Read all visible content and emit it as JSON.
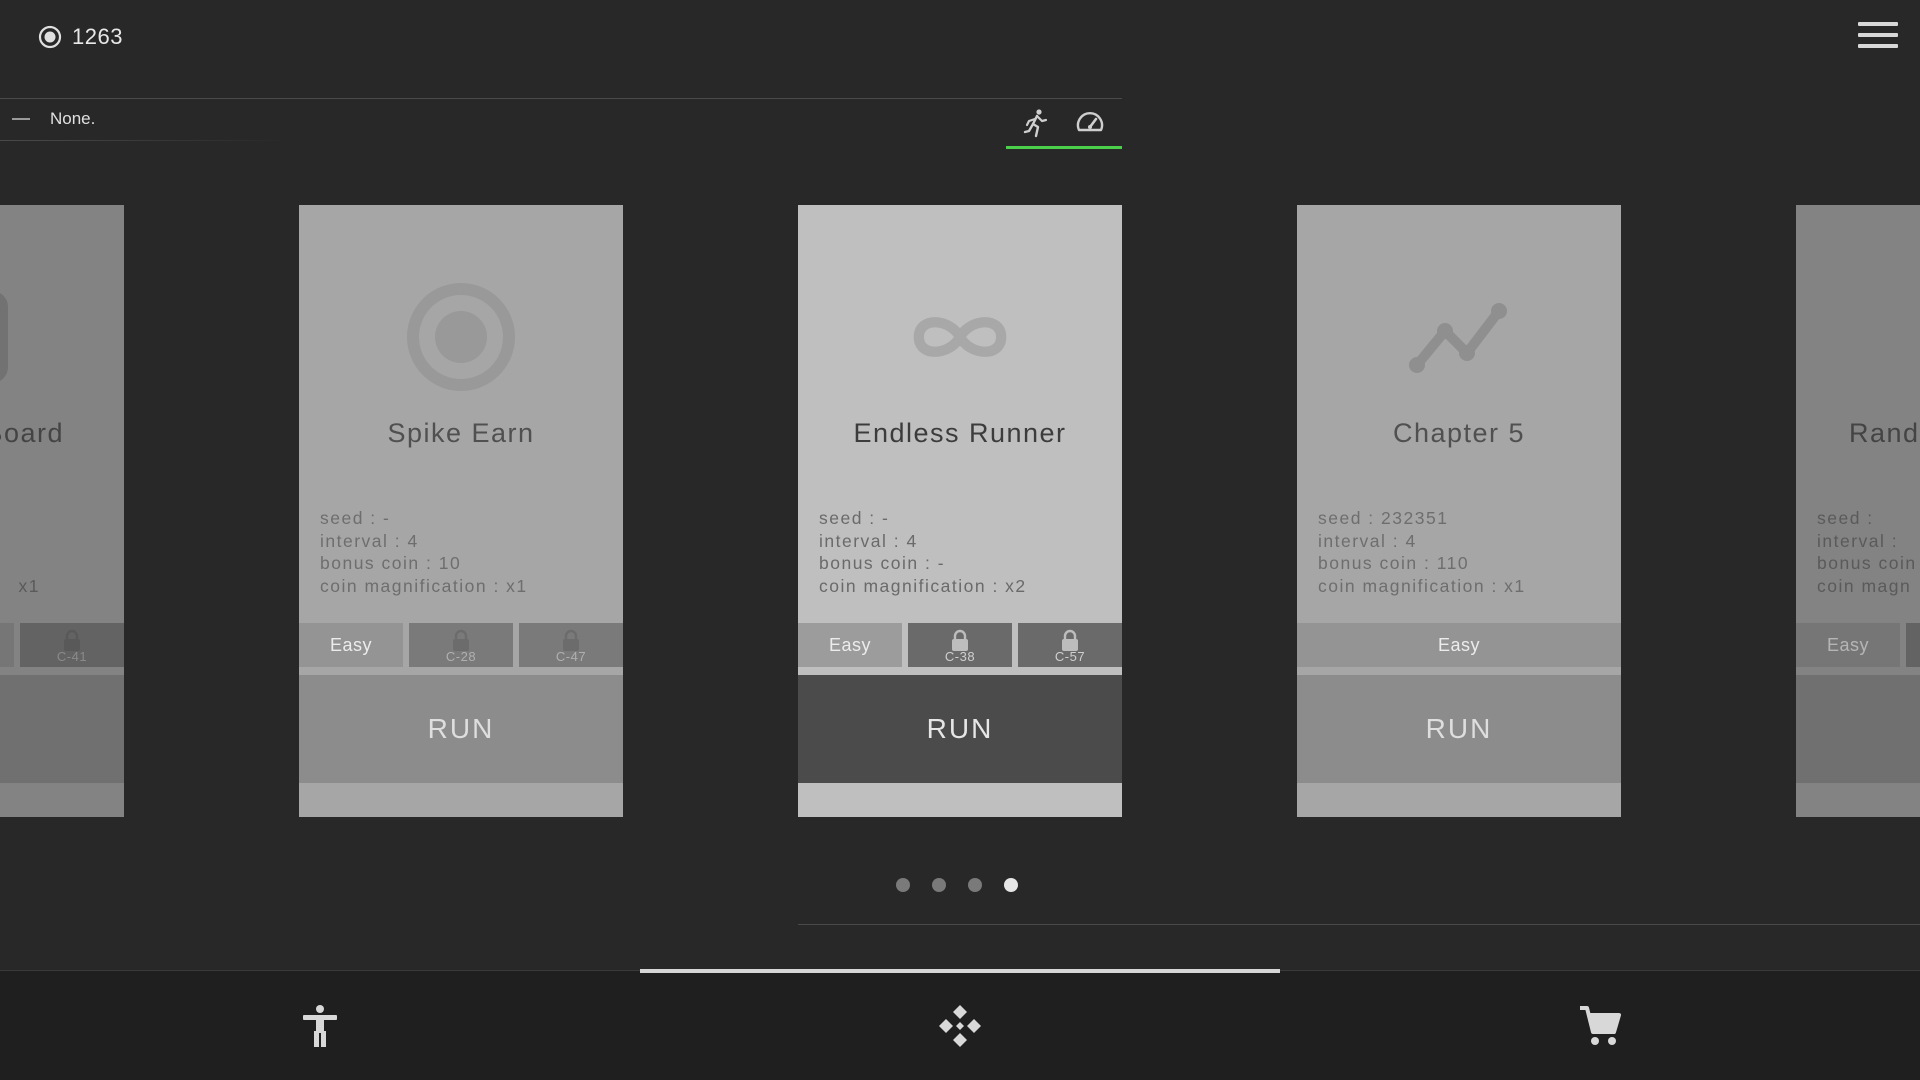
{
  "header": {
    "coin_count": "1263",
    "coin_icon": "target-coin-icon",
    "menu_icon": "hamburger-menu-icon"
  },
  "status": {
    "text": "None.",
    "mode_icons": [
      "running-figure-icon",
      "speedometer-icon"
    ],
    "active_accent": "#4cd04c"
  },
  "cards": [
    {
      "title": "Board",
      "icon": "board-icon",
      "seed": "",
      "interval": "",
      "bonus_coin": "",
      "coin_mag": "x1",
      "difficulties": [
        {
          "label": ""
        },
        {
          "label": "C-41",
          "locked": true
        }
      ],
      "run_label": ""
    },
    {
      "title": "Spike Earn",
      "icon": "target-icon",
      "seed": "seed : -",
      "interval": "interval : 4",
      "bonus_coin": "bonus coin : 10",
      "coin_mag": "coin magnification : x1",
      "difficulties": [
        {
          "label": "Easy"
        },
        {
          "label": "C-28",
          "locked": true
        },
        {
          "label": "C-47",
          "locked": true
        }
      ],
      "run_label": "RUN"
    },
    {
      "title": "Endless Runner",
      "icon": "infinity-icon",
      "seed": "seed : -",
      "interval": "interval : 4",
      "bonus_coin": "bonus coin : -",
      "coin_mag": "coin magnification : x2",
      "difficulties": [
        {
          "label": "Easy"
        },
        {
          "label": "C-38",
          "locked": true
        },
        {
          "label": "C-57",
          "locked": true
        }
      ],
      "run_label": "RUN"
    },
    {
      "title": "Chapter 5",
      "icon": "line-graph-icon",
      "seed": "seed : 232351",
      "interval": "interval : 4",
      "bonus_coin": "bonus coin : 110",
      "coin_mag": "coin magnification : x1",
      "difficulties": [
        {
          "label": "Easy"
        }
      ],
      "run_label": "RUN"
    },
    {
      "title": "Rand",
      "icon": "random-icon",
      "seed": "seed :",
      "interval": "interval :",
      "bonus_coin": "bonus coin",
      "coin_mag": "coin magn",
      "difficulties": [
        {
          "label": "Easy"
        }
      ],
      "run_label": ""
    }
  ],
  "pager": {
    "count": 4,
    "active_index": 3
  },
  "bottom_nav": {
    "items": [
      "accessibility-figure-icon",
      "diamond-dpad-icon",
      "shopping-cart-icon"
    ],
    "active_index": 1
  }
}
